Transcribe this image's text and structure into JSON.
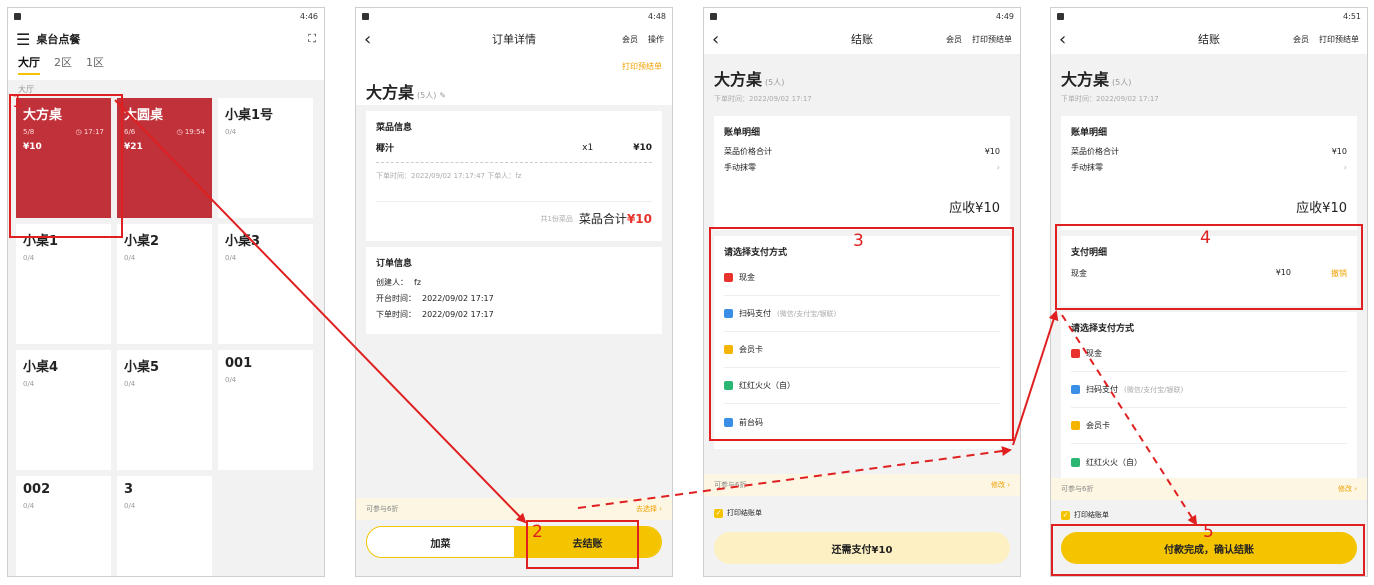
{
  "screen1": {
    "time": "4:46",
    "title": "桌台点餐",
    "tabs": [
      "大厅",
      "2区",
      "1区"
    ],
    "hall_label": "大厅",
    "tables": [
      {
        "name": "大方桌",
        "count": "5/8",
        "time": "◷ 17:17",
        "amount": "¥10",
        "busy": true
      },
      {
        "name": "大圆桌",
        "count": "6/6",
        "time": "◷ 19:54",
        "amount": "¥21",
        "busy": true
      },
      {
        "name": "小桌1号",
        "count": "0/4",
        "time": "",
        "amount": "",
        "busy": false
      },
      {
        "name": "小桌1",
        "count": "0/4",
        "time": "",
        "amount": "",
        "busy": false
      },
      {
        "name": "小桌2",
        "count": "0/4",
        "time": "",
        "amount": "",
        "busy": false
      },
      {
        "name": "小桌3",
        "count": "0/4",
        "time": "",
        "amount": "",
        "busy": false
      },
      {
        "name": "小桌4",
        "count": "0/4",
        "time": "",
        "amount": "",
        "busy": false
      },
      {
        "name": "小桌5",
        "count": "0/4",
        "time": "",
        "amount": "",
        "busy": false
      },
      {
        "name": "001",
        "count": "0/4",
        "time": "",
        "amount": "",
        "busy": false
      },
      {
        "name": "002",
        "count": "0/4",
        "time": "",
        "amount": "",
        "busy": false
      },
      {
        "name": "3",
        "count": "0/4",
        "time": "",
        "amount": "",
        "busy": false
      }
    ]
  },
  "screen2": {
    "time": "4:48",
    "title": "订单详情",
    "member": "会员",
    "ops": "操作",
    "table_name": "大方桌",
    "people": "(5人)",
    "print_pre": "打印预结单",
    "dish_info": "菜品信息",
    "dish_name": "椰汁",
    "dish_qty": "x1",
    "dish_price": "¥10",
    "order_line": "下单时间：2022/09/02 17:17:47    下单人：fz",
    "total_count": "共1份菜品",
    "total_label": "菜品合计",
    "total_amount": "¥10",
    "order_info": "订单信息",
    "creator_label": "创建人：",
    "creator": "fz",
    "open_label": "开台时间：",
    "open_time": "2022/09/02 17:17",
    "order_label": "下单时间：",
    "order_time": "2022/09/02 17:17",
    "discount": "可参与6折",
    "discount_select": "去选择 ›",
    "add_dish": "加菜",
    "checkout": "去结账"
  },
  "screen3": {
    "time": "4:49",
    "title": "结账",
    "member": "会员",
    "print_pre": "打印预结单",
    "table_name": "大方桌",
    "people": "(5人)",
    "order_time": "下单时间：2022/09/02 17:17",
    "bill_detail": "账单明细",
    "dish_total_label": "菜品价格合计",
    "dish_total": "¥10",
    "manual_round": "手动抹零",
    "receivable": "应收¥10",
    "choose_pay": "请选择支付方式",
    "pay_methods": [
      "现金",
      "扫码支付",
      "会员卡",
      "红红火火（自）",
      "前台码"
    ],
    "scan_hint": "(微信/支付宝/银联)",
    "discount": "可参与6折",
    "modify": "修改 ›",
    "print_bill": "打印结账单",
    "pay_button": "还需支付¥10"
  },
  "screen4": {
    "time": "4:51",
    "title": "结账",
    "member": "会员",
    "print_pre": "打印预结单",
    "table_name": "大方桌",
    "people": "(5人)",
    "order_time": "下单时间：2022/09/02 17:17",
    "bill_detail": "账单明细",
    "dish_total_label": "菜品价格合计",
    "dish_total": "¥10",
    "manual_round": "手动抹零",
    "receivable": "应收¥10",
    "pay_detail": "支付明细",
    "paid_method": "现金",
    "paid_amount": "¥10",
    "cancel": "撤销",
    "choose_pay": "请选择支付方式",
    "pay_methods": [
      "现金",
      "扫码支付",
      "会员卡",
      "红红火火（自）"
    ],
    "scan_hint": "(微信/支付宝/银联)",
    "discount": "可参与6折",
    "modify": "修改 ›",
    "print_bill": "打印结账单",
    "confirm_button": "付款完成，确认结账"
  },
  "steps": [
    "1",
    "2",
    "3",
    "4",
    "5"
  ],
  "colors": {
    "accent": "#f5c400",
    "busy": "#c0313a",
    "annotation": "#e02020",
    "price": "#e8332c"
  }
}
